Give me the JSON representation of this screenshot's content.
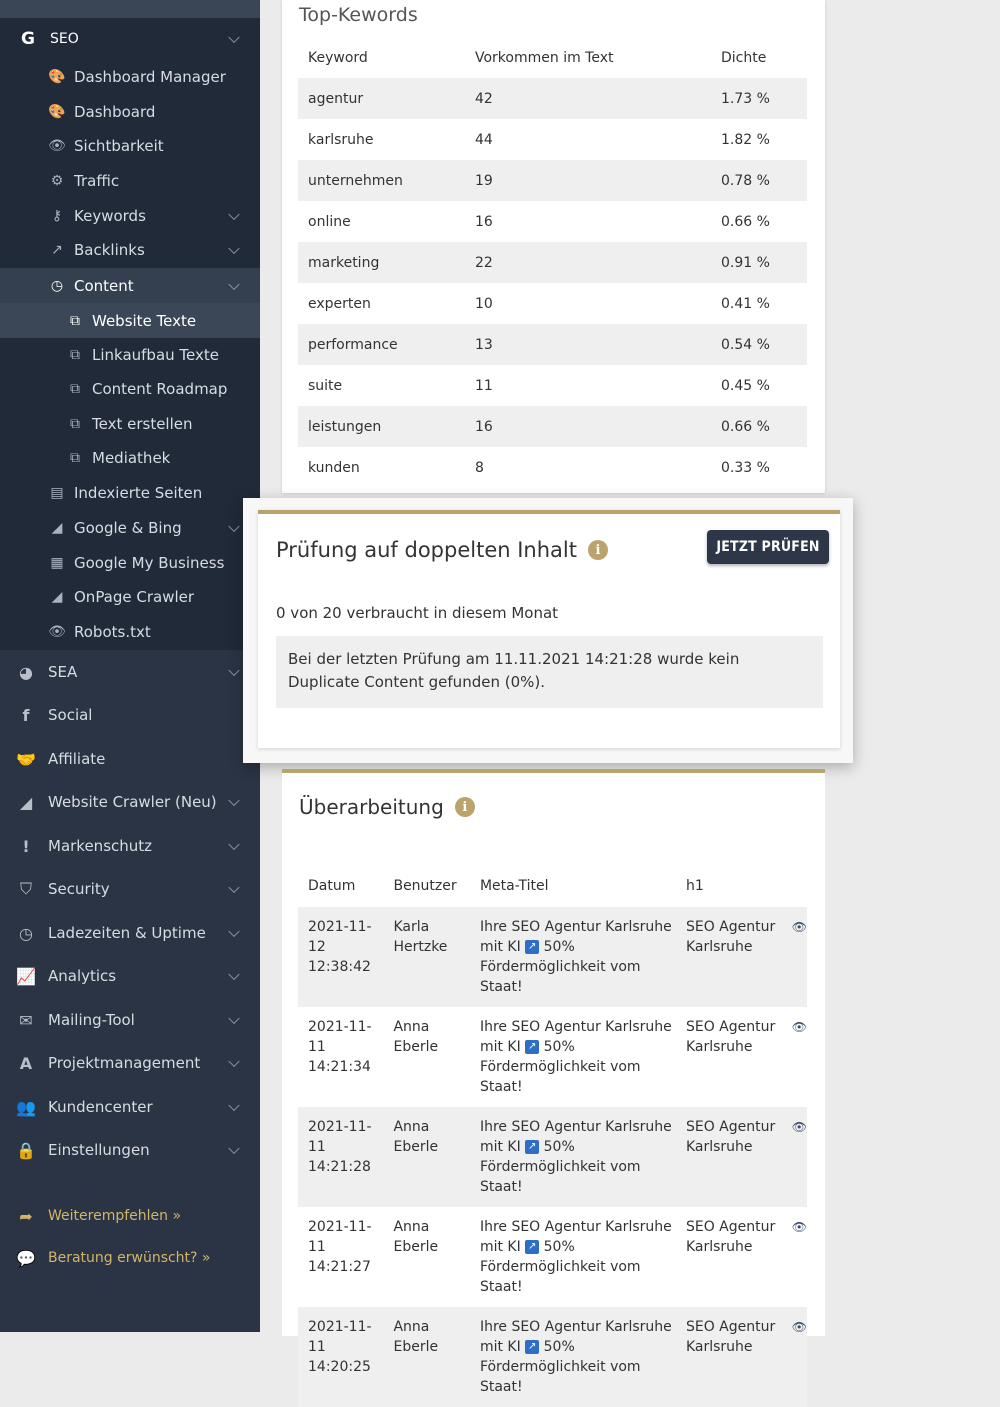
{
  "sidebar": {
    "seo": {
      "label": "SEO",
      "icon": "google-g-icon"
    },
    "seo_items": [
      {
        "label": "Dashboard Manager",
        "icon": "palette-icon"
      },
      {
        "label": "Dashboard",
        "icon": "palette-icon"
      },
      {
        "label": "Sichtbarkeit",
        "icon": "eye-icon"
      },
      {
        "label": "Traffic",
        "icon": "cogs-icon"
      },
      {
        "label": "Keywords",
        "icon": "key-icon"
      },
      {
        "label": "Backlinks",
        "icon": "external-link-icon"
      },
      {
        "label": "Content",
        "icon": "clock-icon"
      },
      {
        "label": "Website Texte",
        "icon": "clone-icon"
      },
      {
        "label": "Linkaufbau Texte",
        "icon": "clone-icon"
      },
      {
        "label": "Content Roadmap",
        "icon": "clone-icon"
      },
      {
        "label": "Text erstellen",
        "icon": "clone-icon"
      },
      {
        "label": "Mediathek",
        "icon": "clone-icon"
      },
      {
        "label": "Indexierte Seiten",
        "icon": "file-icon"
      },
      {
        "label": "Google & Bing",
        "icon": "area-chart-icon"
      },
      {
        "label": "Google My Business",
        "icon": "store-icon"
      },
      {
        "label": "OnPage Crawler",
        "icon": "area-chart-icon"
      },
      {
        "label": "Robots.txt",
        "icon": "eye-icon"
      }
    ],
    "main_items": [
      {
        "label": "SEA",
        "icon": "pie-chart-icon"
      },
      {
        "label": "Social",
        "icon": "facebook-icon"
      },
      {
        "label": "Affiliate",
        "icon": "handshake-icon"
      },
      {
        "label": "Website Crawler (Neu)",
        "icon": "area-chart-icon"
      },
      {
        "label": "Markenschutz",
        "icon": "exclamation-icon"
      },
      {
        "label": "Security",
        "icon": "shield-icon"
      },
      {
        "label": "Ladezeiten & Uptime",
        "icon": "clock-icon"
      },
      {
        "label": "Analytics",
        "icon": "line-chart-icon"
      },
      {
        "label": "Mailing-Tool",
        "icon": "envelope-icon"
      },
      {
        "label": "Projektmanagement",
        "icon": "drafting-icon"
      },
      {
        "label": "Kundencenter",
        "icon": "users-icon"
      },
      {
        "label": "Einstellungen",
        "icon": "lock-icon"
      }
    ],
    "footer_items": [
      {
        "label": "Weiterempfehlen »",
        "icon": "share-arrow-icon"
      },
      {
        "label": "Beratung erwünscht? »",
        "icon": "comments-icon"
      }
    ]
  },
  "top_keywords": {
    "title": "Top-Kewords",
    "columns": [
      "Keyword",
      "Vorkommen im Text",
      "Dichte"
    ],
    "rows": [
      {
        "keyword": "agentur",
        "count": "42",
        "density": "1.73 %"
      },
      {
        "keyword": "karlsruhe",
        "count": "44",
        "density": "1.82 %"
      },
      {
        "keyword": "unternehmen",
        "count": "19",
        "density": "0.78 %"
      },
      {
        "keyword": "online",
        "count": "16",
        "density": "0.66 %"
      },
      {
        "keyword": "marketing",
        "count": "22",
        "density": "0.91 %"
      },
      {
        "keyword": "experten",
        "count": "10",
        "density": "0.41 %"
      },
      {
        "keyword": "performance",
        "count": "13",
        "density": "0.54 %"
      },
      {
        "keyword": "suite",
        "count": "11",
        "density": "0.45 %"
      },
      {
        "keyword": "leistungen",
        "count": "16",
        "density": "0.66 %"
      },
      {
        "keyword": "kunden",
        "count": "8",
        "density": "0.33 %"
      }
    ]
  },
  "duplicate_check": {
    "title": "Prüfung auf doppelten Inhalt",
    "button": "JETZT PRÜFEN",
    "usage": "0 von 20 verbraucht in diesem Monat",
    "result": "Bei der letzten Prüfung am 11.11.2021 14:21:28 wurde kein Duplicate Content gefunden (0%)."
  },
  "revision": {
    "title": "Überarbeitung",
    "columns": [
      "Datum",
      "Benutzer",
      "Meta-Titel",
      "h1"
    ],
    "rows": [
      {
        "date": "2021-11-12",
        "time": "12:38:42",
        "first": "Karla",
        "last": "Hertzke",
        "meta1": "Ihre SEO Agentur Karlsruhe",
        "meta2a": "mit KI",
        "meta2b": "50%",
        "meta3": "Fördermöglichkeit vom",
        "meta4": "Staat!",
        "h1a": "SEO Agentur",
        "h1b": "Karlsruhe"
      },
      {
        "date": "2021-11-11",
        "time": "14:21:34",
        "first": "Anna",
        "last": "Eberle",
        "meta1": "Ihre SEO Agentur Karlsruhe",
        "meta2a": "mit KI",
        "meta2b": "50%",
        "meta3": "Fördermöglichkeit vom",
        "meta4": "Staat!",
        "h1a": "SEO Agentur",
        "h1b": "Karlsruhe"
      },
      {
        "date": "2021-11-11",
        "time": "14:21:28",
        "first": "Anna",
        "last": "Eberle",
        "meta1": "Ihre SEO Agentur Karlsruhe",
        "meta2a": "mit KI",
        "meta2b": "50%",
        "meta3": "Fördermöglichkeit vom",
        "meta4": "Staat!",
        "h1a": "SEO Agentur",
        "h1b": "Karlsruhe"
      },
      {
        "date": "2021-11-11",
        "time": "14:21:27",
        "first": "Anna",
        "last": "Eberle",
        "meta1": "Ihre SEO Agentur Karlsruhe",
        "meta2a": "mit KI",
        "meta2b": "50%",
        "meta3": "Fördermöglichkeit vom",
        "meta4": "Staat!",
        "h1a": "SEO Agentur",
        "h1b": "Karlsruhe"
      },
      {
        "date": "2021-11-11",
        "time": "14:20:25",
        "first": "Anna",
        "last": "Eberle",
        "meta1": "Ihre SEO Agentur Karlsruhe",
        "meta2a": "mit KI",
        "meta2b": "50%",
        "meta3": "Fördermöglichkeit vom",
        "meta4": "Staat!",
        "h1a": "SEO Agentur",
        "h1b": "Karlsruhe"
      }
    ]
  },
  "colors": {
    "sidebar": "#2a3444",
    "accent": "#b8a46a",
    "button": "#2d3748"
  }
}
